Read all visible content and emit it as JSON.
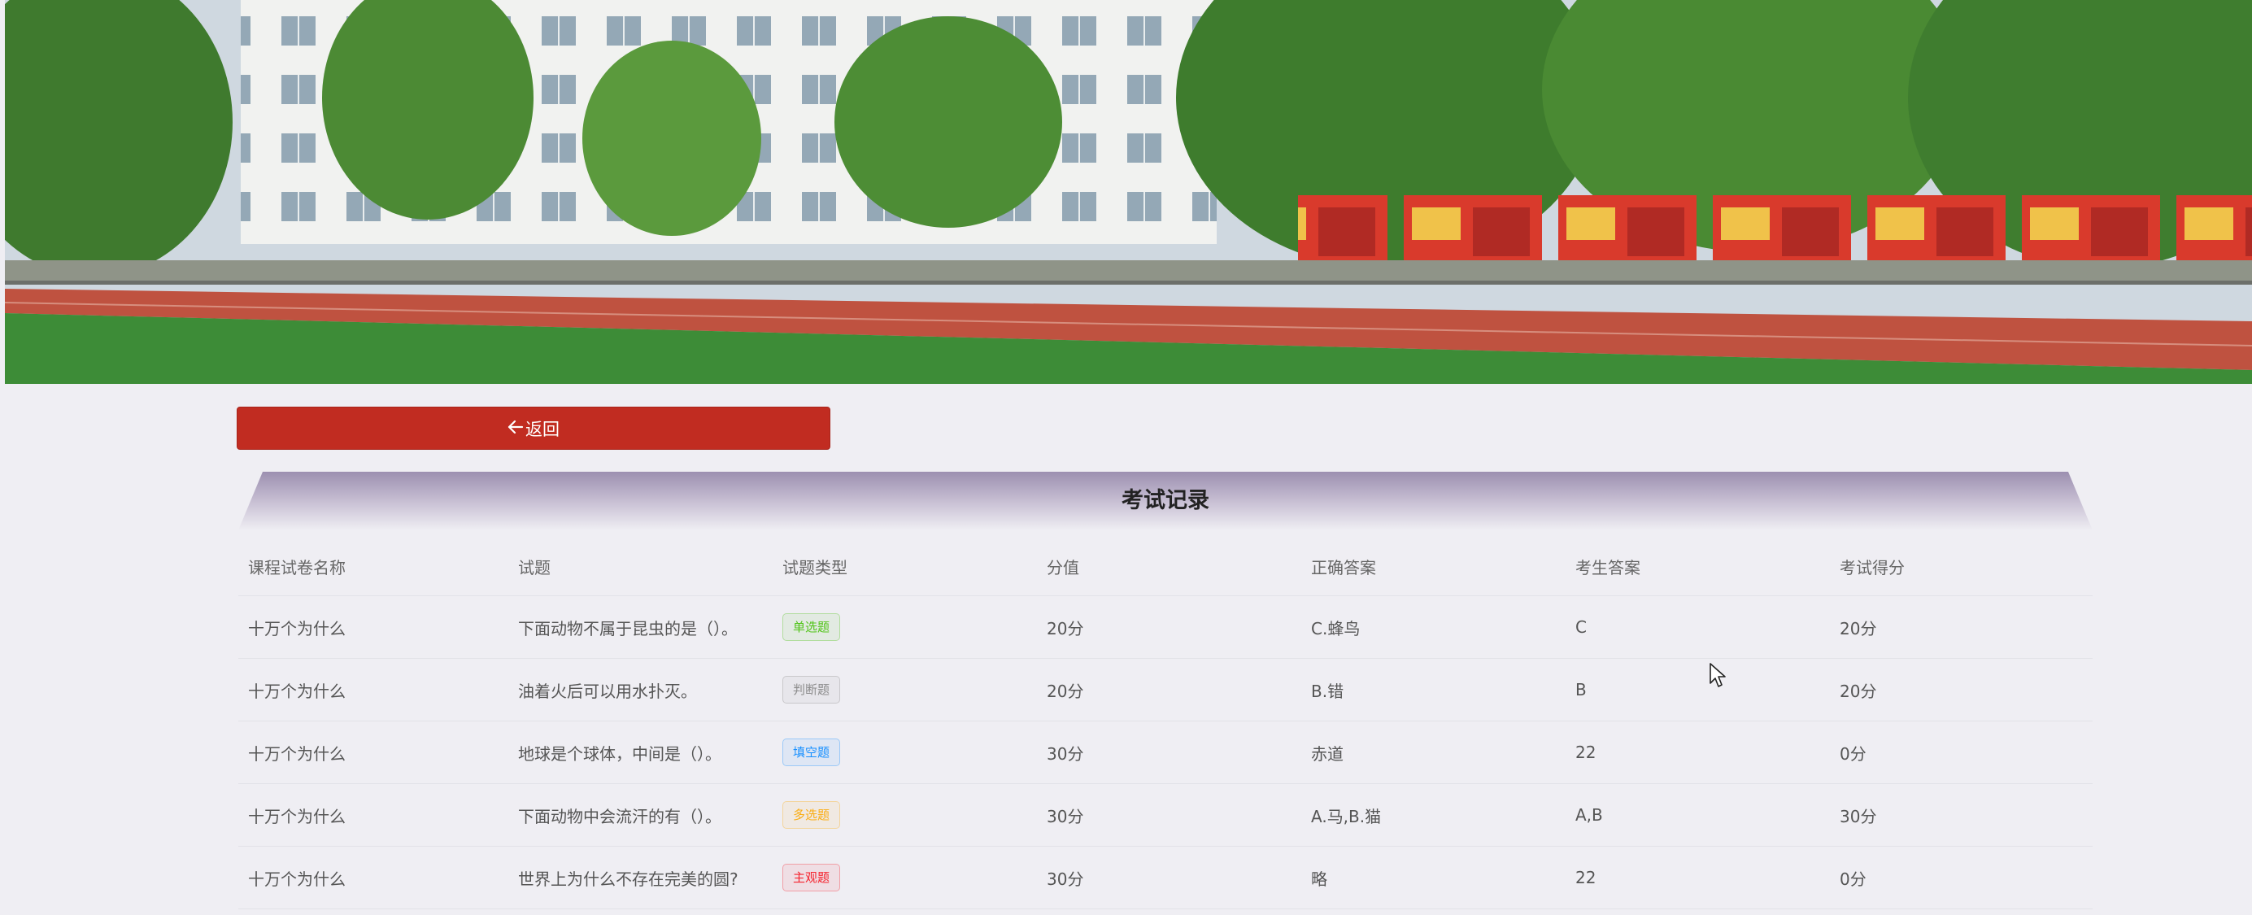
{
  "back_button": {
    "icon": "arrow-left-icon",
    "label": "返回"
  },
  "panel": {
    "title": "考试记录"
  },
  "table": {
    "columns": [
      "课程试卷名称",
      "试题",
      "试题类型",
      "分值",
      "正确答案",
      "考生答案",
      "考试得分"
    ],
    "rows": [
      {
        "paper": "十万个为什么",
        "question": "下面动物不属于昆虫的是（）。",
        "type": "单选题",
        "type_color": "#52c41a",
        "score_value": "20分",
        "correct": "C.蜂鸟",
        "answer": "C",
        "earned": "20分"
      },
      {
        "paper": "十万个为什么",
        "question": "油着火后可以用水扑灭。",
        "type": "判断题",
        "type_color": "#8c8c8c",
        "score_value": "20分",
        "correct": "B.错",
        "answer": "B",
        "earned": "20分"
      },
      {
        "paper": "十万个为什么",
        "question": "地球是个球体，中间是（）。",
        "type": "填空题",
        "type_color": "#1890ff",
        "score_value": "30分",
        "correct": "赤道",
        "answer": "22",
        "earned": "0分"
      },
      {
        "paper": "十万个为什么",
        "question": "下面动物中会流汗的有（）。",
        "type": "多选题",
        "type_color": "#faad14",
        "score_value": "30分",
        "correct": "A.马,B.猫",
        "answer": "A,B",
        "earned": "30分"
      },
      {
        "paper": "十万个为什么",
        "question": "世界上为什么不存在完美的圆?",
        "type": "主观题",
        "type_color": "#f5222d",
        "score_value": "30分",
        "correct": "略",
        "answer": "22",
        "earned": "0分"
      }
    ]
  },
  "colors": {
    "accent": "#c12c21",
    "header_band": "#a79bb8",
    "page_bg": "#efeef3"
  }
}
